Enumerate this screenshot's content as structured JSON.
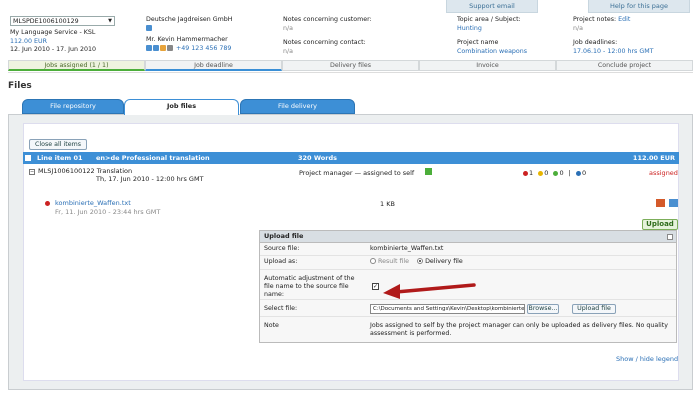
{
  "topbar": {
    "support": "Support email",
    "help": "Help for this page"
  },
  "header": {
    "job_select": "MLSPDE1006100129",
    "job_sub": "My Language Service - KSL",
    "price": "112.00 EUR",
    "dates": "12. Jun 2010 - 17. Jun 2010",
    "company": "Deutsche Jagdreisen GmbH",
    "company_h": "H",
    "contact_name": "Mr. Kevin Hammermacher",
    "contact_phone": "+49 123 456 789",
    "notes_customer_label": "Notes concerning customer:",
    "notes_customer_val": "n/a",
    "notes_contact_label": "Notes concerning contact:",
    "notes_contact_val": "n/a",
    "topic_label": "Topic area / Subject:",
    "topic_val": "Hunting",
    "project_name_label": "Project name",
    "project_name_val": "Combination weapons",
    "project_notes_label": "Project notes:",
    "project_notes_edit": "Edit",
    "project_notes_val": "n/a",
    "deadlines_label": "Job deadlines:",
    "deadlines_val": "17.06.10 - 12:00 hrs GMT"
  },
  "tabs": [
    "Jobs assigned (1 / 1)",
    "Job deadline",
    "Delivery files",
    "Invoice",
    "Conclude project"
  ],
  "files_title": "Files",
  "file_tabs": [
    "File repository",
    "Job files",
    "File delivery"
  ],
  "close_all": "Close all items",
  "line_item": {
    "title": "Line item 01",
    "pair": "en>de Professional translation",
    "words": "320 Words",
    "price": "112.00 EUR"
  },
  "sub_item": {
    "id": "MLSJ1006100122 Translation",
    "date": "Th, 17. Jun 2010 - 12:00 hrs GMT",
    "pm": "Project manager — assigned to self",
    "c1": "1",
    "c2": "0",
    "c3": "0",
    "sep": "|",
    "c4": "0",
    "status": "assigned"
  },
  "file": {
    "name": "kombinierte_Waffen.txt",
    "date": "Fr, 11. Jun 2010 - 23:44 hrs GMT",
    "size": "1 KB"
  },
  "upload_btn": "Upload",
  "upload_box": {
    "title": "Upload file",
    "source_label": "Source file:",
    "source_val": "kombinierte_Waffen.txt",
    "upload_as_label": "Upload as:",
    "opt_result": "Result file",
    "opt_delivery": "Delivery file",
    "auto_label": "Automatic adjustment of the file name to the source file name:",
    "select_label": "Select file:",
    "file_path": "C:\\Documents and Settings\\Kevin\\Desktop\\kombinierte",
    "browse": "Browse...",
    "upload_file": "Upload file",
    "note_label": "Note",
    "note_val": "Jobs assigned to self by the project manager can only be uploaded as delivery files. No quality assessment is performed."
  },
  "legend_link": "Show / hide legend",
  "colors": {
    "accent": "#3d8fd6",
    "arrow": "#b01a1a",
    "status": "#cc2222"
  }
}
